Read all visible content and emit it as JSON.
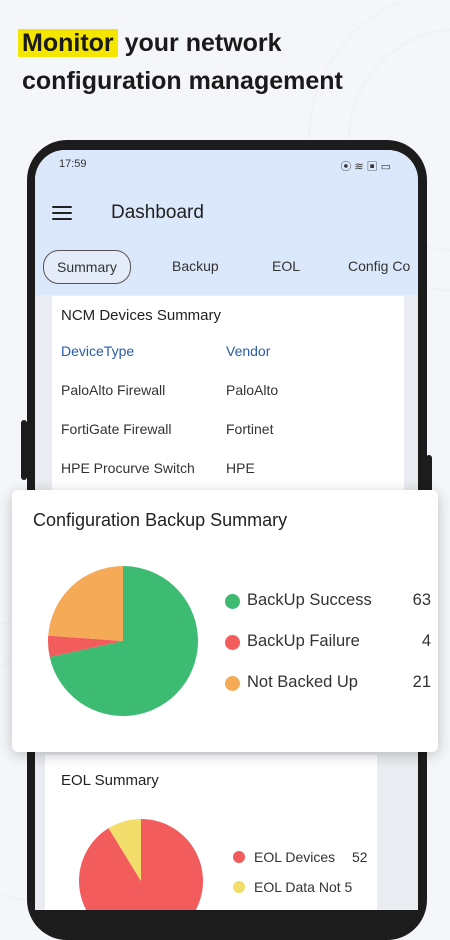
{
  "headline": {
    "highlight": "Monitor",
    "rest": " your network configuration management"
  },
  "status_bar": {
    "time": "17:59",
    "icons": [
      "vibrate-icon",
      "wifi-icon",
      "sim-icon",
      "battery-icon"
    ]
  },
  "app_bar": {
    "title": "Dashboard"
  },
  "tabs": [
    {
      "label": "Summary",
      "active": true
    },
    {
      "label": "Backup"
    },
    {
      "label": "EOL"
    },
    {
      "label": "Config Co"
    }
  ],
  "ncm_summary": {
    "title": "NCM Devices Summary",
    "headers": {
      "device_type": "DeviceType",
      "vendor": "Vendor"
    },
    "rows": [
      {
        "device_type": "PaloAlto Firewall",
        "vendor": "PaloAlto"
      },
      {
        "device_type": "FortiGate Firewall",
        "vendor": "Fortinet"
      },
      {
        "device_type": "HPE Procurve Switch",
        "vendor": "HPE"
      }
    ]
  },
  "backup_summary": {
    "title": "Configuration Backup Summary",
    "colors": {
      "success": "#3dbb73",
      "failure": "#f25c5c",
      "not_backed": "#f5aa58"
    }
  },
  "eol_summary": {
    "title": "EOL Summary",
    "colors": {
      "eol_devices": "#f25c5c",
      "eol_data_not": "#f2dd6a"
    }
  },
  "chart_data": [
    {
      "type": "pie",
      "title": "Configuration Backup Summary",
      "categories": [
        "BackUp Success",
        "BackUp Failure",
        "Not Backed Up"
      ],
      "values": [
        63,
        4,
        21
      ]
    },
    {
      "type": "pie",
      "title": "EOL Summary",
      "categories": [
        "EOL Devices",
        "EOL Data Not 5"
      ],
      "values": [
        52,
        5
      ]
    }
  ]
}
